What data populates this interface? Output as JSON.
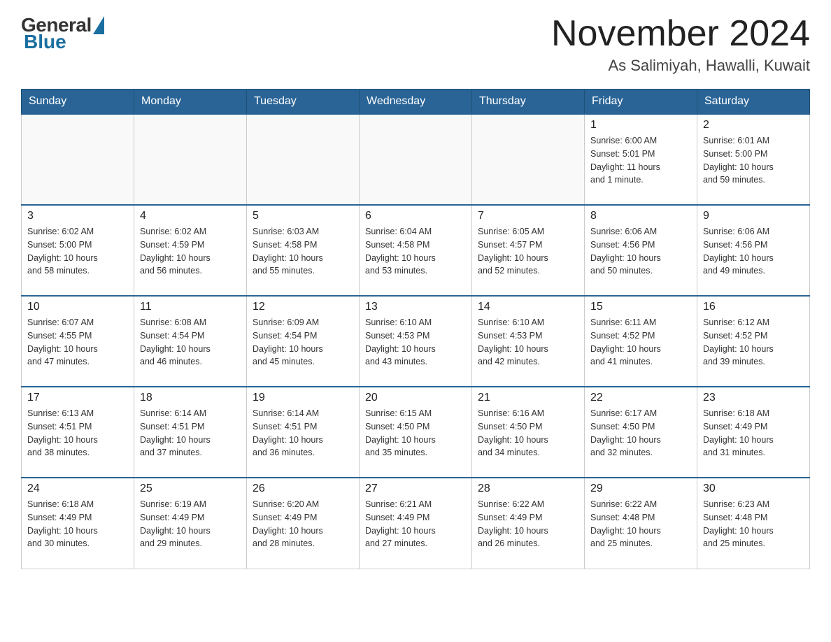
{
  "header": {
    "logo": {
      "general": "General",
      "blue": "Blue"
    },
    "title": "November 2024",
    "location": "As Salimiyah, Hawalli, Kuwait"
  },
  "calendar": {
    "days_of_week": [
      "Sunday",
      "Monday",
      "Tuesday",
      "Wednesday",
      "Thursday",
      "Friday",
      "Saturday"
    ],
    "weeks": [
      [
        {
          "day": "",
          "info": ""
        },
        {
          "day": "",
          "info": ""
        },
        {
          "day": "",
          "info": ""
        },
        {
          "day": "",
          "info": ""
        },
        {
          "day": "",
          "info": ""
        },
        {
          "day": "1",
          "info": "Sunrise: 6:00 AM\nSunset: 5:01 PM\nDaylight: 11 hours\nand 1 minute."
        },
        {
          "day": "2",
          "info": "Sunrise: 6:01 AM\nSunset: 5:00 PM\nDaylight: 10 hours\nand 59 minutes."
        }
      ],
      [
        {
          "day": "3",
          "info": "Sunrise: 6:02 AM\nSunset: 5:00 PM\nDaylight: 10 hours\nand 58 minutes."
        },
        {
          "day": "4",
          "info": "Sunrise: 6:02 AM\nSunset: 4:59 PM\nDaylight: 10 hours\nand 56 minutes."
        },
        {
          "day": "5",
          "info": "Sunrise: 6:03 AM\nSunset: 4:58 PM\nDaylight: 10 hours\nand 55 minutes."
        },
        {
          "day": "6",
          "info": "Sunrise: 6:04 AM\nSunset: 4:58 PM\nDaylight: 10 hours\nand 53 minutes."
        },
        {
          "day": "7",
          "info": "Sunrise: 6:05 AM\nSunset: 4:57 PM\nDaylight: 10 hours\nand 52 minutes."
        },
        {
          "day": "8",
          "info": "Sunrise: 6:06 AM\nSunset: 4:56 PM\nDaylight: 10 hours\nand 50 minutes."
        },
        {
          "day": "9",
          "info": "Sunrise: 6:06 AM\nSunset: 4:56 PM\nDaylight: 10 hours\nand 49 minutes."
        }
      ],
      [
        {
          "day": "10",
          "info": "Sunrise: 6:07 AM\nSunset: 4:55 PM\nDaylight: 10 hours\nand 47 minutes."
        },
        {
          "day": "11",
          "info": "Sunrise: 6:08 AM\nSunset: 4:54 PM\nDaylight: 10 hours\nand 46 minutes."
        },
        {
          "day": "12",
          "info": "Sunrise: 6:09 AM\nSunset: 4:54 PM\nDaylight: 10 hours\nand 45 minutes."
        },
        {
          "day": "13",
          "info": "Sunrise: 6:10 AM\nSunset: 4:53 PM\nDaylight: 10 hours\nand 43 minutes."
        },
        {
          "day": "14",
          "info": "Sunrise: 6:10 AM\nSunset: 4:53 PM\nDaylight: 10 hours\nand 42 minutes."
        },
        {
          "day": "15",
          "info": "Sunrise: 6:11 AM\nSunset: 4:52 PM\nDaylight: 10 hours\nand 41 minutes."
        },
        {
          "day": "16",
          "info": "Sunrise: 6:12 AM\nSunset: 4:52 PM\nDaylight: 10 hours\nand 39 minutes."
        }
      ],
      [
        {
          "day": "17",
          "info": "Sunrise: 6:13 AM\nSunset: 4:51 PM\nDaylight: 10 hours\nand 38 minutes."
        },
        {
          "day": "18",
          "info": "Sunrise: 6:14 AM\nSunset: 4:51 PM\nDaylight: 10 hours\nand 37 minutes."
        },
        {
          "day": "19",
          "info": "Sunrise: 6:14 AM\nSunset: 4:51 PM\nDaylight: 10 hours\nand 36 minutes."
        },
        {
          "day": "20",
          "info": "Sunrise: 6:15 AM\nSunset: 4:50 PM\nDaylight: 10 hours\nand 35 minutes."
        },
        {
          "day": "21",
          "info": "Sunrise: 6:16 AM\nSunset: 4:50 PM\nDaylight: 10 hours\nand 34 minutes."
        },
        {
          "day": "22",
          "info": "Sunrise: 6:17 AM\nSunset: 4:50 PM\nDaylight: 10 hours\nand 32 minutes."
        },
        {
          "day": "23",
          "info": "Sunrise: 6:18 AM\nSunset: 4:49 PM\nDaylight: 10 hours\nand 31 minutes."
        }
      ],
      [
        {
          "day": "24",
          "info": "Sunrise: 6:18 AM\nSunset: 4:49 PM\nDaylight: 10 hours\nand 30 minutes."
        },
        {
          "day": "25",
          "info": "Sunrise: 6:19 AM\nSunset: 4:49 PM\nDaylight: 10 hours\nand 29 minutes."
        },
        {
          "day": "26",
          "info": "Sunrise: 6:20 AM\nSunset: 4:49 PM\nDaylight: 10 hours\nand 28 minutes."
        },
        {
          "day": "27",
          "info": "Sunrise: 6:21 AM\nSunset: 4:49 PM\nDaylight: 10 hours\nand 27 minutes."
        },
        {
          "day": "28",
          "info": "Sunrise: 6:22 AM\nSunset: 4:49 PM\nDaylight: 10 hours\nand 26 minutes."
        },
        {
          "day": "29",
          "info": "Sunrise: 6:22 AM\nSunset: 4:48 PM\nDaylight: 10 hours\nand 25 minutes."
        },
        {
          "day": "30",
          "info": "Sunrise: 6:23 AM\nSunset: 4:48 PM\nDaylight: 10 hours\nand 25 minutes."
        }
      ]
    ]
  }
}
